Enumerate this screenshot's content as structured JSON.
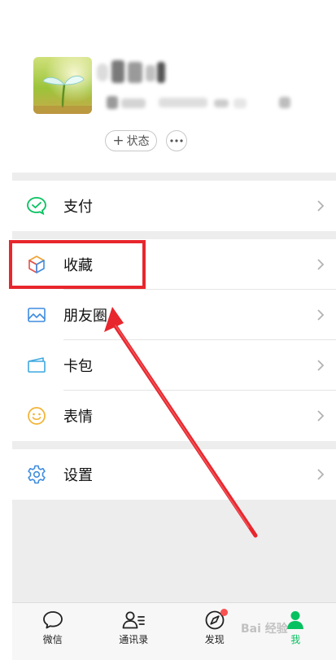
{
  "profile": {
    "status_label": "状态",
    "status_plus": "+"
  },
  "menu": [
    {
      "label": "支付",
      "icon": "wechat-pay-icon"
    },
    {
      "label": "收藏",
      "icon": "favorites-cube-icon"
    },
    {
      "label": "朋友圈",
      "icon": "moments-image-icon"
    },
    {
      "label": "卡包",
      "icon": "card-wallet-icon"
    },
    {
      "label": "表情",
      "icon": "sticker-smile-icon"
    },
    {
      "label": "设置",
      "icon": "settings-gear-icon"
    }
  ],
  "tabbar": [
    {
      "label": "微信",
      "icon": "chat-bubble-icon",
      "active": false
    },
    {
      "label": "通讯录",
      "icon": "contacts-icon",
      "active": false
    },
    {
      "label": "发现",
      "icon": "compass-icon",
      "active": false,
      "badge": true
    },
    {
      "label": "我",
      "icon": "me-person-icon",
      "active": true
    }
  ],
  "watermark": "Bai 经验",
  "colors": {
    "accent_green": "#07c160",
    "badge_red": "#fa5151",
    "annotation_red": "#e8262d",
    "background": "#ededed"
  }
}
